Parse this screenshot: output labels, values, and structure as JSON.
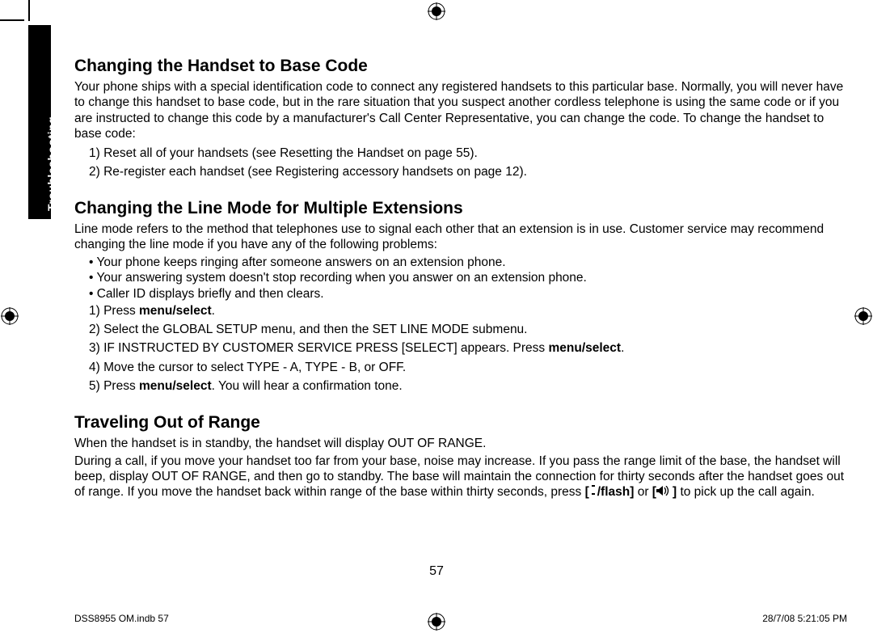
{
  "sidetab": {
    "label": "Troubleshooting"
  },
  "section1": {
    "heading": "Changing the Handset to Base Code",
    "para": "Your phone ships with a special identification code to connect any registered handsets to this particular base. Normally, you will never have to change this handset to base code, but in the rare situation that you suspect another cordless telephone is using the same code or if you are instructed to change this code by a manufacturer's Call Center Representative, you can change the code. To change the handset to base code:",
    "steps": [
      "1)  Reset all of your handsets (see Resetting the Handset on page 55).",
      "2)  Re-register each handset (see Registering accessory handsets on page 12)."
    ]
  },
  "section2": {
    "heading": "Changing the Line Mode for Multiple Extensions",
    "para": "Line mode refers to the method that telephones use to signal each other that an extension is in use. Customer service may recommend changing the line mode if you have any of the following problems:",
    "bullets": [
      "• Your phone keeps ringing after someone answers on an extension phone.",
      "• Your answering system doesn't stop recording when you answer on an extension phone.",
      "• Caller ID displays briefly and then clears."
    ],
    "step1_a": "1)  Press ",
    "step1_b": "menu/select",
    "step1_c": ".",
    "step2": "2)  Select the GLOBAL SETUP menu, and then the SET LINE MODE submenu.",
    "step3_a": "3)  IF INSTRUCTED BY CUSTOMER SERVICE PRESS [SELECT] appears. Press ",
    "step3_b": "menu/select",
    "step3_c": ".",
    "step4": "4)  Move the cursor to select TYPE - A, TYPE - B, or OFF.",
    "step5_a": "5)  Press ",
    "step5_b": "menu/select",
    "step5_c": ". You will hear a confirmation tone."
  },
  "section3": {
    "heading": "Traveling Out of Range",
    "para1": "When the handset is in standby, the handset will display OUT OF RANGE.",
    "para2_a": "During a call, if you move your handset too far from your base, noise may increase. If you pass the range limit of the base, the handset will beep, display OUT OF RANGE, and then go to standby. The base will maintain the connection for thirty seconds after the handset goes out of range. If you move the handset back within range of the base within thirty seconds, press ",
    "para2_b": "[",
    "para2_c": "/flash]",
    "para2_d": " or ",
    "para2_e": "[",
    "para2_f": "]",
    "para2_g": " to pick up the call again."
  },
  "page_number": "57",
  "footer": {
    "left": "DSS8955 OM.indb   57",
    "right": "28/7/08   5:21:05 PM"
  }
}
